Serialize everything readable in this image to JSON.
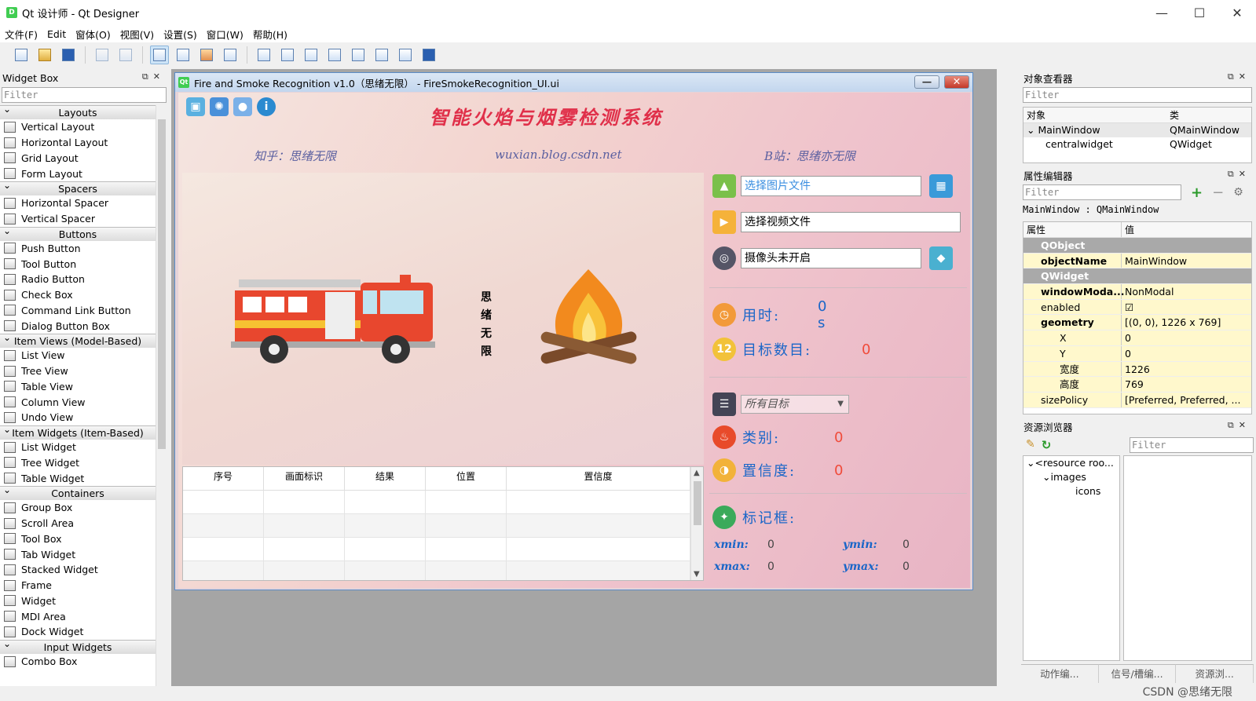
{
  "window": {
    "title": "Qt 设计师 - Qt Designer",
    "min": "—",
    "max": "☐",
    "close": "✕"
  },
  "menu": [
    "文件(F)",
    "Edit",
    "窗体(O)",
    "视图(V)",
    "设置(S)",
    "窗口(W)",
    "帮助(H)"
  ],
  "widget_box": {
    "title": "Widget Box",
    "filter_placeholder": "Filter",
    "categories": [
      {
        "name": "Layouts",
        "items": [
          "Vertical Layout",
          "Horizontal Layout",
          "Grid Layout",
          "Form Layout"
        ]
      },
      {
        "name": "Spacers",
        "items": [
          "Horizontal Spacer",
          "Vertical Spacer"
        ]
      },
      {
        "name": "Buttons",
        "items": [
          "Push Button",
          "Tool Button",
          "Radio Button",
          "Check Box",
          "Command Link Button",
          "Dialog Button Box"
        ]
      },
      {
        "name": "Item Views (Model-Based)",
        "items": [
          "List View",
          "Tree View",
          "Table View",
          "Column View",
          "Undo View"
        ]
      },
      {
        "name": "Item Widgets (Item-Based)",
        "items": [
          "List Widget",
          "Tree Widget",
          "Table Widget"
        ]
      },
      {
        "name": "Containers",
        "items": [
          "Group Box",
          "Scroll Area",
          "Tool Box",
          "Tab Widget",
          "Stacked Widget",
          "Frame",
          "Widget",
          "MDI Area",
          "Dock Widget"
        ]
      },
      {
        "name": "Input Widgets",
        "items": [
          "Combo Box"
        ]
      }
    ]
  },
  "form": {
    "title": "Fire and Smoke Recognition v1.0（思绪无限） - FireSmokeRecognition_UI.ui",
    "app_title": "智能火焰与烟雾检测系统",
    "credits": [
      "知乎：思绪无限",
      "wuxian.blog.csdn.net",
      "B站：思绪亦无限"
    ],
    "vertical_text": [
      "思",
      "绪",
      "无",
      "限"
    ],
    "table_headers": [
      "序号",
      "画面标识",
      "结果",
      "位置",
      "置信度"
    ],
    "select_image": "选择图片文件",
    "select_video": "选择视频文件",
    "camera": "摄像头未开启",
    "time_label": "用时:",
    "time_value": "0 s",
    "count_label": "目标数目:",
    "count_value": "0",
    "combo_value": "所有目标",
    "class_label": "类别:",
    "class_value": "0",
    "conf_label": "置信度:",
    "conf_value": "0",
    "box_label": "标记框:",
    "xmin_label": "xmin:",
    "xmin": "0",
    "ymin_label": "ymin:",
    "ymin": "0",
    "xmax_label": "xmax:",
    "xmax": "0",
    "ymax_label": "ymax:",
    "ymax": "0"
  },
  "object_inspector": {
    "title": "对象查看器",
    "filter_placeholder": "Filter",
    "col_object": "对象",
    "col_class": "类",
    "rows": [
      {
        "object": "MainWindow",
        "class": "QMainWindow"
      },
      {
        "object": "centralwidget",
        "class": "QWidget"
      }
    ]
  },
  "property_editor": {
    "title": "属性编辑器",
    "filter_placeholder": "Filter",
    "context": "MainWindow : QMainWindow",
    "col_prop": "属性",
    "col_value": "值",
    "rows": [
      {
        "name": "QObject",
        "value": "",
        "type": "group"
      },
      {
        "name": "objectName",
        "value": "MainWindow",
        "type": "bold"
      },
      {
        "name": "QWidget",
        "value": "",
        "type": "group"
      },
      {
        "name": "windowModa...",
        "value": "NonModal",
        "type": "bold"
      },
      {
        "name": "enabled",
        "value": "☑",
        "type": "normal"
      },
      {
        "name": "geometry",
        "value": "[(0, 0), 1226 x 769]",
        "type": "bold"
      },
      {
        "name": "X",
        "value": "0",
        "type": "sub"
      },
      {
        "name": "Y",
        "value": "0",
        "type": "sub"
      },
      {
        "name": "宽度",
        "value": "1226",
        "type": "sub"
      },
      {
        "name": "高度",
        "value": "769",
        "type": "sub"
      },
      {
        "name": "sizePolicy",
        "value": "[Preferred, Preferred, ...",
        "type": "normal"
      }
    ]
  },
  "resource_browser": {
    "title": "资源浏览器",
    "filter_placeholder": "Filter",
    "tree": [
      "<resource roo...",
      "images",
      "icons"
    ]
  },
  "bottom_tabs": [
    "动作编...",
    "信号/槽编...",
    "资源浏..."
  ],
  "watermark": "CSDN @思绪无限",
  "colors": {
    "accent_red": "#e0304a",
    "label_blue": "#1a66c8",
    "value_orange": "#f04b3a",
    "group_gray": "#a9a9a9",
    "cream": "#fff8cc"
  }
}
